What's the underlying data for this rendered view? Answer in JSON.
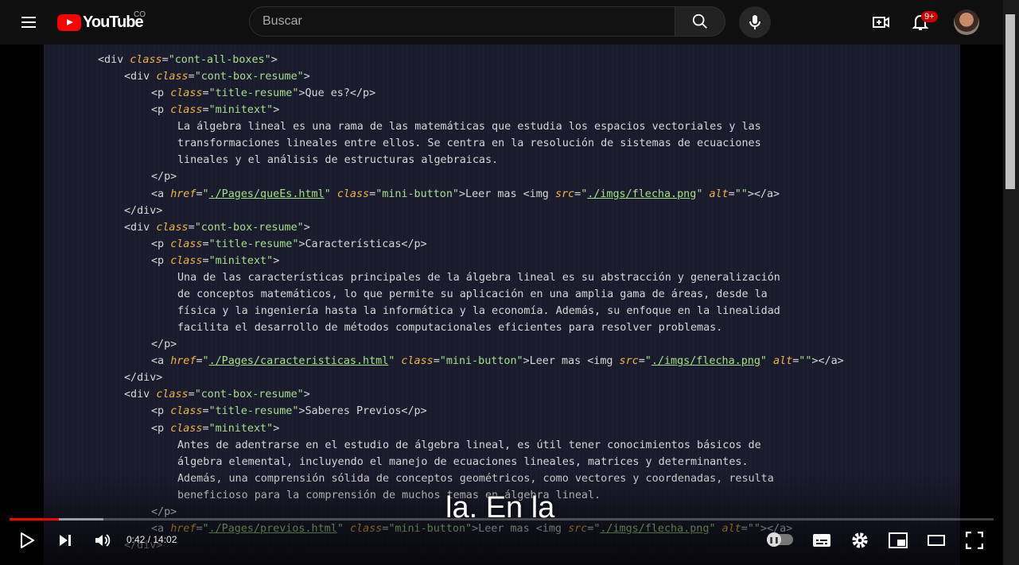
{
  "header": {
    "logo_text": "YouTube",
    "country_code": "CO",
    "search_placeholder": "Buscar",
    "notif_count": "9+"
  },
  "icons": {
    "menu": "menu-icon",
    "search": "search-icon",
    "mic": "mic-icon",
    "create": "create-video-icon",
    "bell": "bell-icon"
  },
  "colors": {
    "brand": "#ff0000",
    "tag": "#d7d7d7",
    "attr": "#f0b640",
    "string": "#a3e088",
    "code_bg": "#1b1b2e"
  },
  "video": {
    "code_lines": [
      [
        [
          "tag",
          "<div "
        ],
        [
          "attr",
          "class"
        ],
        [
          "tag",
          "="
        ],
        [
          "str",
          "\"cont-all-boxes\""
        ],
        [
          "tag",
          ">"
        ]
      ],
      [
        [
          "tag",
          "<div "
        ],
        [
          "attr",
          "class"
        ],
        [
          "tag",
          "="
        ],
        [
          "str",
          "\"cont-box-resume\""
        ],
        [
          "tag",
          ">"
        ]
      ],
      [
        [
          "tag",
          "<p "
        ],
        [
          "attr",
          "class"
        ],
        [
          "tag",
          "="
        ],
        [
          "str",
          "\"title-resume\""
        ],
        [
          "tag",
          ">Que es?</p>"
        ]
      ],
      [
        [
          "tag",
          "<p "
        ],
        [
          "attr",
          "class"
        ],
        [
          "tag",
          "="
        ],
        [
          "str",
          "\"minitext\""
        ],
        [
          "tag",
          ">"
        ]
      ],
      [
        [
          "tag",
          "La álgebra lineal es una rama de las matemáticas que estudia los espacios vectoriales y las"
        ]
      ],
      [
        [
          "tag",
          "transformaciones lineales entre ellos. Se centra en la resolución de sistemas de ecuaciones"
        ]
      ],
      [
        [
          "tag",
          "lineales y el análisis de estructuras algebraicas."
        ]
      ],
      [
        [
          "tag",
          "</p>"
        ]
      ],
      [
        [
          "tag",
          "<a "
        ],
        [
          "attr",
          "href"
        ],
        [
          "tag",
          "="
        ],
        [
          "str",
          "\""
        ],
        [
          "lnk",
          "./Pages/queEs.html"
        ],
        [
          "str",
          "\""
        ],
        [
          "tag",
          " "
        ],
        [
          "attr",
          "class"
        ],
        [
          "tag",
          "="
        ],
        [
          "str",
          "\"mini-button\""
        ],
        [
          "tag",
          ">Leer mas <img "
        ],
        [
          "attr",
          "src"
        ],
        [
          "tag",
          "="
        ],
        [
          "str",
          "\""
        ],
        [
          "lnk",
          "./imgs/flecha.png"
        ],
        [
          "str",
          "\""
        ],
        [
          "tag",
          " "
        ],
        [
          "attr",
          "alt"
        ],
        [
          "tag",
          "="
        ],
        [
          "str",
          "\"\""
        ],
        [
          "tag",
          "></a>"
        ]
      ],
      [
        [
          "tag",
          "</div>"
        ]
      ],
      [
        [
          "tag",
          "<div "
        ],
        [
          "attr",
          "class"
        ],
        [
          "tag",
          "="
        ],
        [
          "str",
          "\"cont-box-resume\""
        ],
        [
          "tag",
          ">"
        ]
      ],
      [
        [
          "tag",
          "<p "
        ],
        [
          "attr",
          "class"
        ],
        [
          "tag",
          "="
        ],
        [
          "str",
          "\"title-resume\""
        ],
        [
          "tag",
          ">Características</p>"
        ]
      ],
      [
        [
          "tag",
          "<p "
        ],
        [
          "attr",
          "class"
        ],
        [
          "tag",
          "="
        ],
        [
          "str",
          "\"minitext\""
        ],
        [
          "tag",
          ">"
        ]
      ],
      [
        [
          "tag",
          "Una de las características principales de la álgebra lineal es su abstracción y generalización"
        ]
      ],
      [
        [
          "tag",
          "de conceptos matemáticos, lo que permite su aplicación en una amplia gama de áreas, desde la"
        ]
      ],
      [
        [
          "tag",
          "física y la ingeniería hasta la informática y la economía. Además, su enfoque en la linealidad"
        ]
      ],
      [
        [
          "tag",
          "facilita el desarrollo de métodos computacionales eficientes para resolver problemas."
        ]
      ],
      [
        [
          "tag",
          "</p>"
        ]
      ],
      [
        [
          "tag",
          "<a "
        ],
        [
          "attr",
          "href"
        ],
        [
          "tag",
          "="
        ],
        [
          "str",
          "\""
        ],
        [
          "lnk",
          "./Pages/caracteristicas.html"
        ],
        [
          "str",
          "\""
        ],
        [
          "tag",
          " "
        ],
        [
          "attr",
          "class"
        ],
        [
          "tag",
          "="
        ],
        [
          "str",
          "\"mini-button\""
        ],
        [
          "tag",
          ">Leer mas <img "
        ],
        [
          "attr",
          "src"
        ],
        [
          "tag",
          "="
        ],
        [
          "str",
          "\""
        ],
        [
          "lnk",
          "./imgs/flecha.png"
        ],
        [
          "str",
          "\""
        ],
        [
          "tag",
          " "
        ],
        [
          "attr",
          "alt"
        ],
        [
          "tag",
          "="
        ],
        [
          "str",
          "\"\""
        ],
        [
          "tag",
          "></a>"
        ]
      ],
      [
        [
          "tag",
          "</div>"
        ]
      ],
      [
        [
          "tag",
          "<div "
        ],
        [
          "attr",
          "class"
        ],
        [
          "tag",
          "="
        ],
        [
          "str",
          "\"cont-box-resume\""
        ],
        [
          "tag",
          ">"
        ]
      ],
      [
        [
          "tag",
          "<p "
        ],
        [
          "attr",
          "class"
        ],
        [
          "tag",
          "="
        ],
        [
          "str",
          "\"title-resume\""
        ],
        [
          "tag",
          ">Saberes Previos</p>"
        ]
      ],
      [
        [
          "tag",
          "<p "
        ],
        [
          "attr",
          "class"
        ],
        [
          "tag",
          "="
        ],
        [
          "str",
          "\"minitext\""
        ],
        [
          "tag",
          ">"
        ]
      ],
      [
        [
          "tag",
          "Antes de adentrarse en el estudio de álgebra lineal, es útil tener conocimientos básicos de"
        ]
      ],
      [
        [
          "tag",
          "álgebra elemental, incluyendo el manejo de ecuaciones lineales, matrices y determinantes."
        ]
      ],
      [
        [
          "tag",
          "Además, una comprensión sólida de conceptos geométricos, como vectores y coordenadas, resulta"
        ]
      ],
      [
        [
          "tag",
          "beneficioso para la comprensión de muchos temas en álgebra lineal."
        ]
      ],
      [
        [
          "tag",
          "</p>"
        ]
      ],
      [
        [
          "tag",
          "<a "
        ],
        [
          "attr",
          "href"
        ],
        [
          "tag",
          "="
        ],
        [
          "str",
          "\""
        ],
        [
          "lnk",
          "./Pages/previos.html"
        ],
        [
          "str",
          "\""
        ],
        [
          "tag",
          " "
        ],
        [
          "attr",
          "class"
        ],
        [
          "tag",
          "="
        ],
        [
          "str",
          "\"mini-button\""
        ],
        [
          "tag",
          ">Leer mas <img "
        ],
        [
          "attr",
          "src"
        ],
        [
          "tag",
          "="
        ],
        [
          "str",
          "\""
        ],
        [
          "lnk",
          "./imgs/flecha.png"
        ],
        [
          "str",
          "\""
        ],
        [
          "tag",
          " "
        ],
        [
          "attr",
          "alt"
        ],
        [
          "tag",
          "="
        ],
        [
          "str",
          "\"\""
        ],
        [
          "tag",
          "></a>"
        ]
      ],
      [
        [
          "tag",
          "</div>"
        ]
      ]
    ],
    "subtitle": "la. En la"
  },
  "player": {
    "current_time": "0:42",
    "duration": "14:02",
    "time_display": "0:42 / 14:02",
    "progress_fraction": 0.0499,
    "buffered_fraction": 0.095
  }
}
